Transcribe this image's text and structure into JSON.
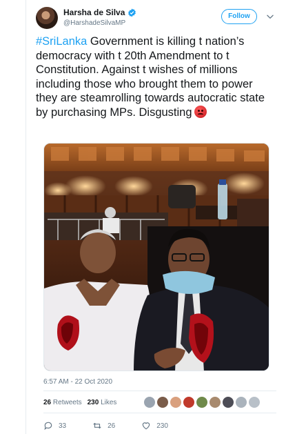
{
  "user": {
    "display_name": "Harsha de Silva",
    "handle": "@HarshadeSilvaMP"
  },
  "header": {
    "follow_label": "Follow"
  },
  "tweet": {
    "hashtag": "#SriLanka",
    "text": " Government is killing t nation’s democracy with t 20th Amendment to t Constitution. Against t wishes of millions including those who brought them to power they are steamrolling towards autocratic state by purchasing MPs. Disgusting",
    "emoji": "angry-face-emoji",
    "timestamp": "6:57 AM - 22 Oct 2020"
  },
  "stats": {
    "retweets_count": "26",
    "retweets_label": "Retweets",
    "likes_count": "230",
    "likes_label": "Likes"
  },
  "actions": {
    "reply_count": "33",
    "retweet_count": "26",
    "like_count": "230"
  },
  "colors": {
    "accent": "#1da1f2",
    "muted": "#657786"
  },
  "icons": [
    "verified-icon",
    "chevron-down-icon",
    "reply-icon",
    "retweet-icon",
    "heart-icon"
  ]
}
